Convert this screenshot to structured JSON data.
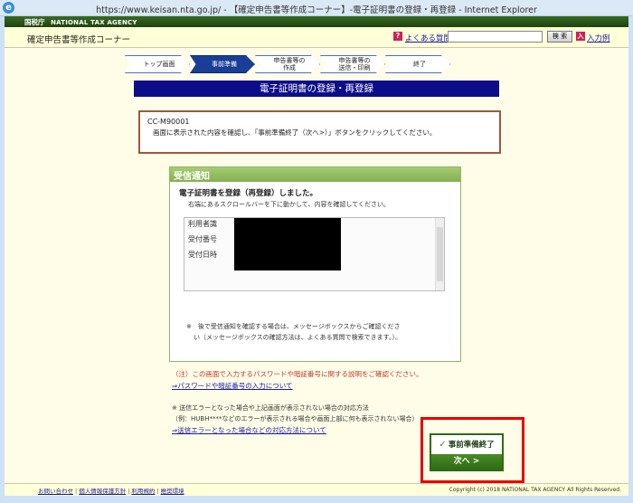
{
  "window": {
    "title": "https://www.keisan.nta.go.jp/ - 【確定申告書等作成コーナー】-電子証明書の登録・再登録 - Internet Explorer",
    "icon": "ie-icon"
  },
  "header": {
    "agency_kanji": "国税庁",
    "agency_en": "NATIONAL TAX AGENCY",
    "site_name": "確定申告書等作成コーナー",
    "faq_icon": "?",
    "faq_link": "よくある質問",
    "search_placeholder": "",
    "search_button": "検 索",
    "example_icon": "入",
    "example_link": "入力例"
  },
  "steps": [
    {
      "label": "トップ画面",
      "active": false
    },
    {
      "label": "事前準備",
      "active": true
    },
    {
      "label": "申告書等の\n作成",
      "active": false
    },
    {
      "label": "申告書等の\n送信・印刷",
      "active": false
    },
    {
      "label": "終了",
      "active": false
    }
  ],
  "page_title": "電子証明書の登録・再登録",
  "instruction": {
    "code": "CC-M90001",
    "message": "画面に表示された内容を確認し、「事前準備終了（次へ>）」ボタンをクリックしてください。"
  },
  "notice": {
    "heading": "受信通知",
    "done_message": "電子証明書を登録（再登録）しました。",
    "scroll_hint": "右端にあるスクロールバーを下に動かして、内容を確認してください。",
    "rows": [
      "利用者識",
      "受付番号",
      "受付日時"
    ],
    "footnote_line1": "※　後で受信通知を確認する場合は、メッセージボックスからご確認くださ",
    "footnote_line2": "い（メッセージボックスの確認方法は、よくある質問で検索できます。）。"
  },
  "notes": {
    "caution": "（注）この画面で入力するパスワードや暗証番号に関する説明をご確認ください。",
    "password_link": "⇒パスワードや暗証番号の入力について",
    "error_note1": "※ 送信エラーとなった場合や上記画面が表示されない場合の対応方法",
    "error_note2": "（例：HUBH****などのエラーが表示される場合や画面上部に何も表示されない場合）",
    "error_link": "⇒送信エラーとなった場合などの対応方法について"
  },
  "finish_button": {
    "check": "✓",
    "label": "事前準備終了",
    "next": "次へ >"
  },
  "footer": {
    "links": [
      "お問い合わせ",
      "個人情報保護方針",
      "利用規約",
      "推奨環境"
    ],
    "separator": "|",
    "copyright": "Copyright (c) 2018 NATIONAL TAX AGENCY All Rights Reserved."
  },
  "colors": {
    "title_bar": "#0d0d8a",
    "active_step": "#1a3e96",
    "notice_head": "#84b050",
    "finish_button": "#2e6b16",
    "highlight": "#e80000",
    "caution_text": "#c0392b"
  }
}
